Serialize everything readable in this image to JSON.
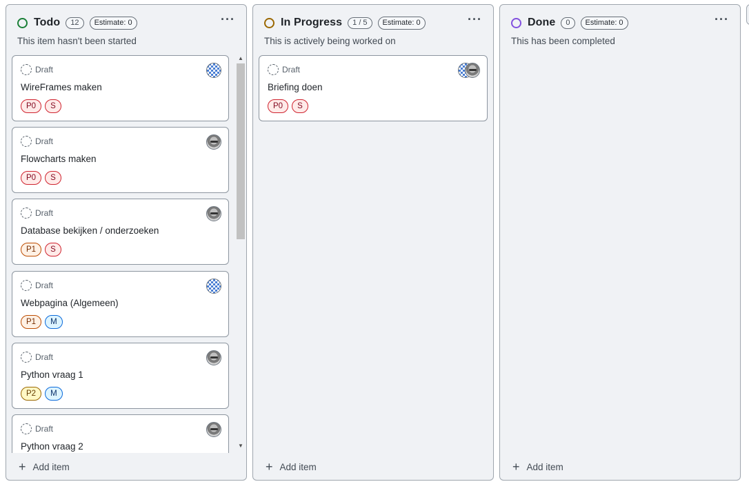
{
  "colors": {
    "todo": "#1a7f37",
    "in_progress": "#9a6700",
    "done": "#8250df"
  },
  "columns": [
    {
      "title": "Todo",
      "count": "12",
      "estimate": "Estimate: 0",
      "description": "This item hasn't been started",
      "menu": "···",
      "add_label": "Add item",
      "cards": [
        {
          "status": "Draft",
          "title": "WireFrames maken",
          "labels": [
            "P0",
            "S"
          ],
          "avatar": "blue"
        },
        {
          "status": "Draft",
          "title": "Flowcharts maken",
          "labels": [
            "P0",
            "S"
          ],
          "avatar": "face"
        },
        {
          "status": "Draft",
          "title": "Database bekijken / onderzoeken",
          "labels": [
            "P1",
            "S"
          ],
          "avatar": "face"
        },
        {
          "status": "Draft",
          "title": "Webpagina (Algemeen)",
          "labels": [
            "P1",
            "M"
          ],
          "avatar": "blue"
        },
        {
          "status": "Draft",
          "title": "Python vraag 1",
          "labels": [
            "P2",
            "M"
          ],
          "avatar": "face"
        },
        {
          "status": "Draft",
          "title": "Python vraag 2",
          "labels": [],
          "avatar": "face"
        }
      ]
    },
    {
      "title": "In Progress",
      "count": "1 / 5",
      "estimate": "Estimate: 0",
      "description": "This is actively being worked on",
      "menu": "···",
      "add_label": "Add item",
      "cards": [
        {
          "status": "Draft",
          "title": "Briefing doen",
          "labels": [
            "P0",
            "S"
          ],
          "avatar": "pair"
        }
      ]
    },
    {
      "title": "Done",
      "count": "0",
      "estimate": "Estimate: 0",
      "description": "This has been completed",
      "menu": "···",
      "add_label": "Add item",
      "cards": []
    }
  ],
  "icons": {
    "status": "status-circle-icon",
    "draft": "draft-dashed-circle-icon",
    "menu": "kebab-menu-icon",
    "add": "plus-icon",
    "avatar": "user-avatar-icon"
  }
}
